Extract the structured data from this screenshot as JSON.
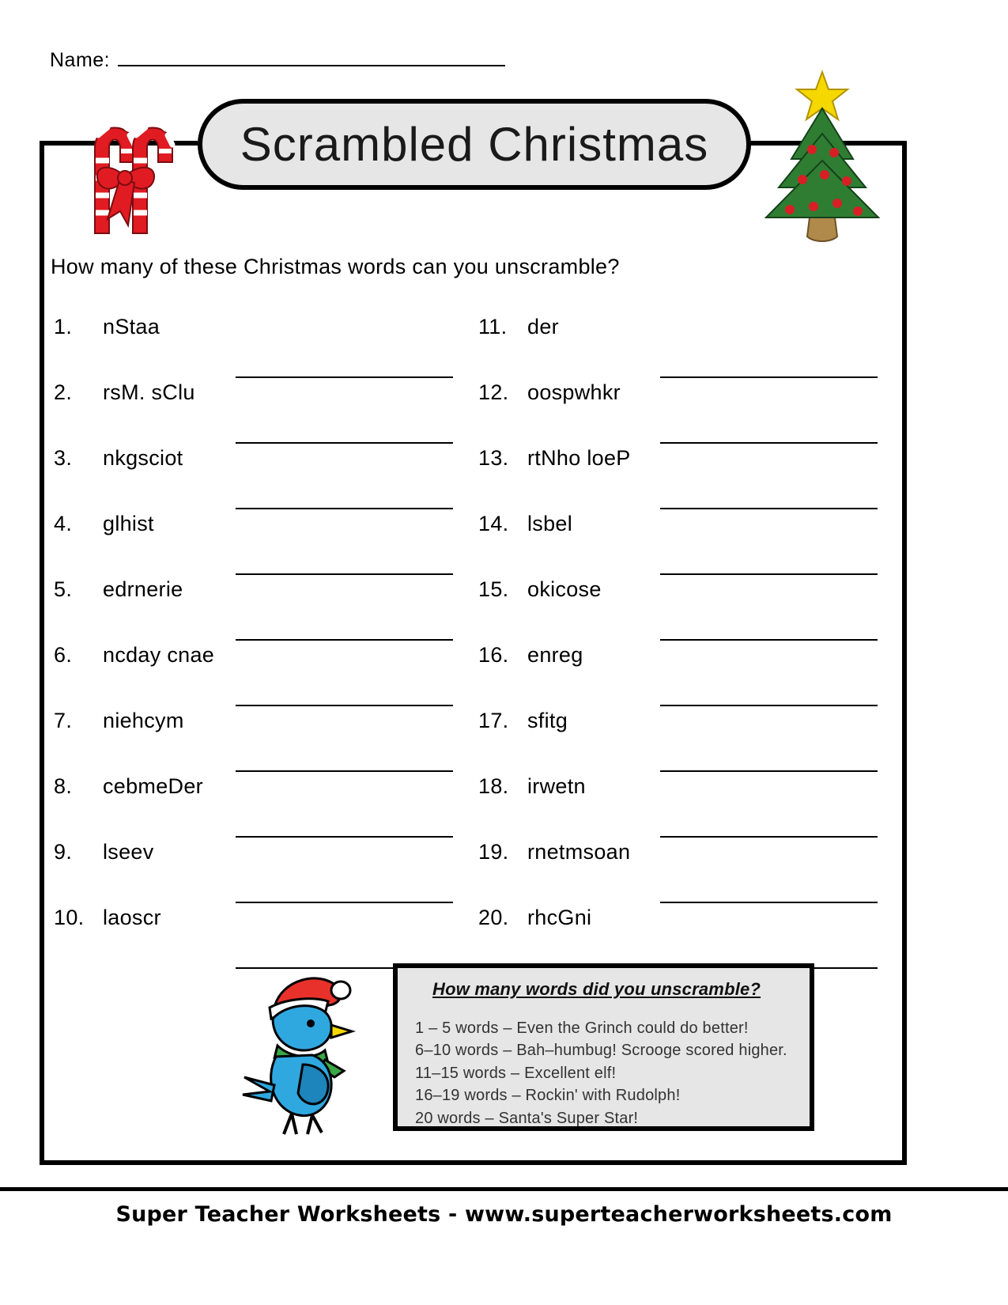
{
  "header": {
    "name_label": "Name:",
    "title": "Scrambled Christmas"
  },
  "instruction": "How many of these Christmas words can you unscramble?",
  "items_left": [
    {
      "num": "1.",
      "word": "nStaa"
    },
    {
      "num": "2.",
      "word": "rsM. sClu"
    },
    {
      "num": "3.",
      "word": "nkgsciot"
    },
    {
      "num": "4.",
      "word": "glhist"
    },
    {
      "num": "5.",
      "word": "edrnerie"
    },
    {
      "num": "6.",
      "word": "ncday cnae"
    },
    {
      "num": "7.",
      "word": "niehcym"
    },
    {
      "num": "8.",
      "word": "cebmeDer"
    },
    {
      "num": "9.",
      "word": "lseev"
    },
    {
      "num": "10.",
      "word": "laoscr"
    }
  ],
  "items_right": [
    {
      "num": "11.",
      "word": "der"
    },
    {
      "num": "12.",
      "word": "oospwhkr"
    },
    {
      "num": "13.",
      "word": "rtNho loeP"
    },
    {
      "num": "14.",
      "word": "lsbel"
    },
    {
      "num": "15.",
      "word": "okicose"
    },
    {
      "num": "16.",
      "word": "enreg"
    },
    {
      "num": "17.",
      "word": "sfitg"
    },
    {
      "num": "18.",
      "word": "irwetn"
    },
    {
      "num": "19.",
      "word": "rnetmsoan"
    },
    {
      "num": "20.",
      "word": "rhcGni"
    }
  ],
  "score_box": {
    "title": "How many words did you unscramble?",
    "lines": [
      "1 – 5 words – Even the Grinch could do better!",
      "6–10 words – Bah–humbug!  Scrooge scored higher.",
      "11–15 words – Excellent elf!",
      "16–19 words – Rockin' with Rudolph!",
      "20 words – Santa's Super Star!"
    ]
  },
  "footer": "Super Teacher Worksheets - www.superteacherworksheets.com",
  "colors": {
    "banner_fill": "#e6e6e6",
    "ink": "#000000",
    "candy_red": "#e11b22",
    "tree_green": "#2f7d32",
    "tree_dark_green": "#1e5c24",
    "ornament_red": "#d81f26",
    "star_yellow": "#f5d800",
    "trunk_brown": "#b08a4a",
    "bird_blue": "#2fa8e0",
    "hat_red": "#e8312a",
    "scarf_green": "#39a845"
  },
  "icons": {
    "candy_canes": "candy-canes-icon",
    "christmas_tree": "christmas-tree-icon",
    "bird": "bird-with-santa-hat-icon"
  }
}
